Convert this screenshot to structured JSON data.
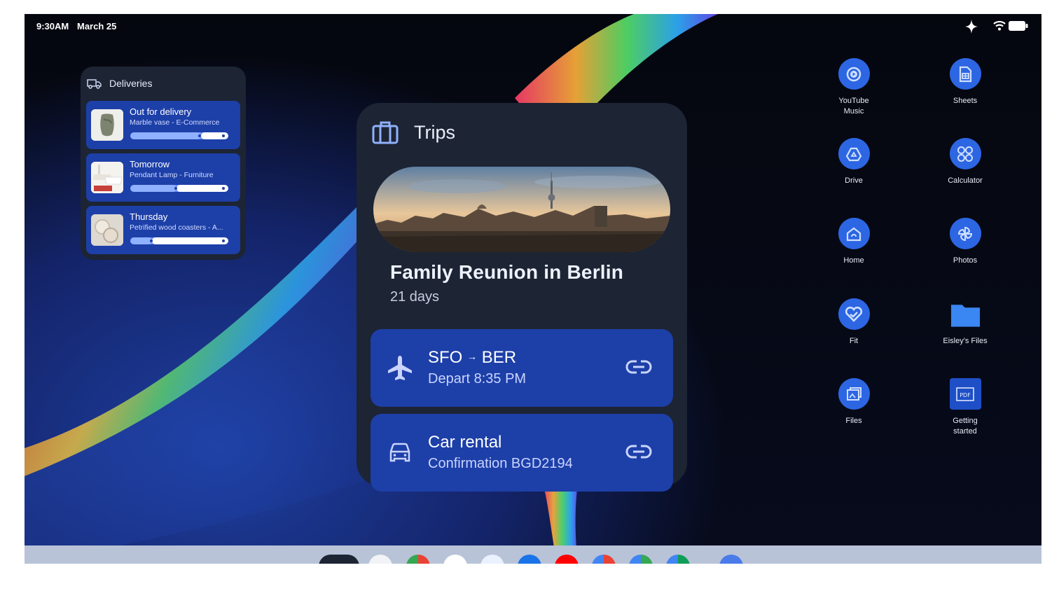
{
  "status_bar": {
    "time": "9:30AM",
    "date": "March 25",
    "icons": [
      "sparkle-icon",
      "wifi-icon",
      "battery-icon"
    ]
  },
  "deliveries": {
    "title": "Deliveries",
    "icon": "delivery-truck-icon",
    "items": [
      {
        "title": "Out for delivery",
        "subtitle": "Marble vase - E-Commerce",
        "progress": 0.72
      },
      {
        "title": "Tomorrow",
        "subtitle": "Pendant Lamp - Furniture",
        "progress": 0.47
      },
      {
        "title": "Thursday",
        "subtitle": "Petrified wood coasters - A...",
        "progress": 0.22
      }
    ]
  },
  "trips": {
    "title": "Trips",
    "icon": "briefcase-icon",
    "trip_name": "Family Reunion in Berlin",
    "trip_length": "21 days",
    "flight": {
      "route_from": "SFO",
      "route_arrow": "→",
      "route_to": "BER",
      "detail": "Depart 8:35 PM",
      "icon": "airplane-icon"
    },
    "car": {
      "title": "Car rental",
      "detail": "Confirmation BGD2194",
      "icon": "car-icon"
    }
  },
  "apps": [
    {
      "label": "YouTube\nMusic",
      "icon": "youtube-music-icon"
    },
    {
      "label": "Sheets",
      "icon": "sheets-icon"
    },
    {
      "label": "Drive",
      "icon": "drive-icon"
    },
    {
      "label": "Calculator",
      "icon": "calculator-icon"
    },
    {
      "label": "Home",
      "icon": "home-icon"
    },
    {
      "label": "Photos",
      "icon": "photos-icon"
    },
    {
      "label": "Fit",
      "icon": "fit-heart-icon"
    },
    {
      "label": "Eisley's Files",
      "icon": "folder-icon"
    },
    {
      "label": "Files",
      "icon": "files-icon"
    },
    {
      "label": "Getting\nstarted",
      "icon": "pdf-icon"
    }
  ],
  "colors": {
    "card_blue": "#1d3fa8",
    "widget_bg": "#1d2433",
    "app_icon_blue": "#2d66e3"
  }
}
